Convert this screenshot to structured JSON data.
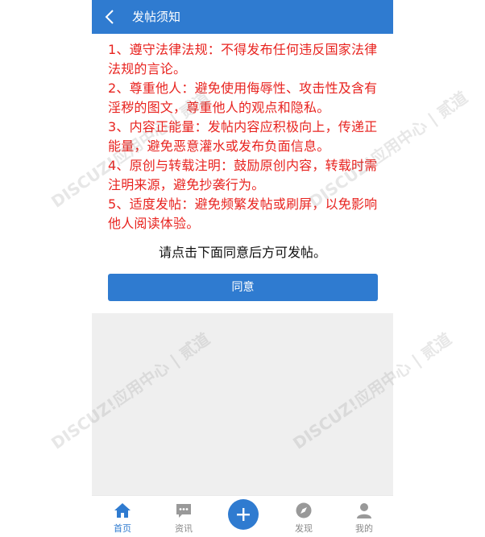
{
  "header": {
    "title": "发帖须知",
    "back_icon": "chevron-left-icon"
  },
  "notice": {
    "items": [
      "1、遵守法律法规：不得发布任何违反国家法律法规的言论。",
      "2、尊重他人：避免使用侮辱性、攻击性及含有淫秽的图文，尊重他人的观点和隐私。",
      "3、内容正能量：发帖内容应积极向上，传递正能量，避免恶意灌水或发布负面信息。",
      "4、原创与转载注明：鼓励原创内容，转载时需注明来源，避免抄袭行为。",
      "5、适度发帖：避免频繁发帖或刷屏，以免影响他人阅读体验。"
    ],
    "color": "#e8231f"
  },
  "prompt": "请点击下面同意后方可发帖。",
  "agree_button": "同意",
  "watermark": "DISCUZ!应用中心 | 贰道",
  "tabbar": {
    "home": "首页",
    "news": "资讯",
    "discover": "发现",
    "me": "我的",
    "post_icon": "plus-icon"
  },
  "colors": {
    "accent": "#2f7bd0",
    "inactive": "#888888"
  }
}
